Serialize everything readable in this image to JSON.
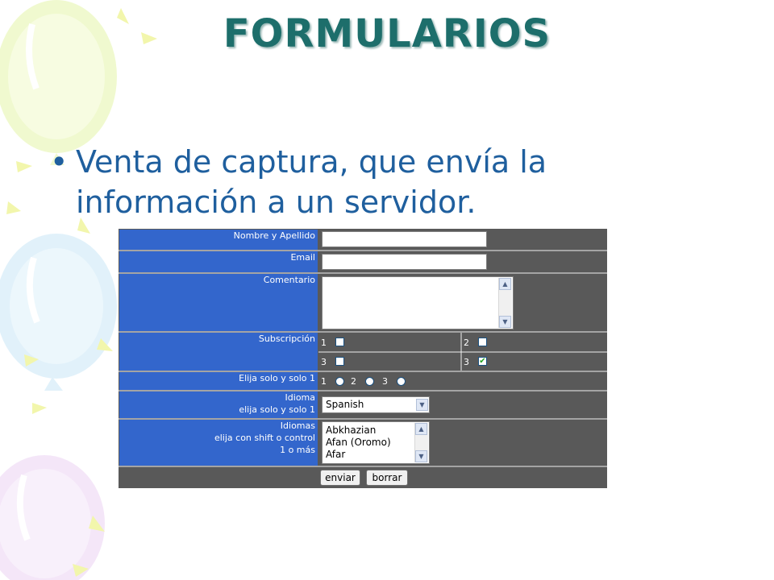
{
  "title": "FORMULARIOS",
  "bullet": {
    "marker": "•",
    "text": "Venta de captura, que envía la información a un servidor."
  },
  "form": {
    "name_label": "Nombre y Apellido",
    "name_value": "",
    "email_label": "Email",
    "email_value": "",
    "comment_label": "Comentario",
    "comment_value": "",
    "subscription_label": "Subscripción",
    "subscription_options": [
      {
        "label": "1",
        "checked": false
      },
      {
        "label": "2",
        "checked": false
      },
      {
        "label": "3",
        "checked": false
      },
      {
        "label": "3",
        "checked": true
      }
    ],
    "radio_label": "Elija solo y solo 1",
    "radio_options": [
      "1",
      "2",
      "3"
    ],
    "language_label_line1": "Idioma",
    "language_label_line2": "elija solo y solo 1",
    "language_selected": "Spanish",
    "languages_label_line1": "Idiomas",
    "languages_label_line2": "elija con shift o control",
    "languages_label_line3": "1 o más",
    "languages_list": [
      "Abkhazian",
      "Afan (Oromo)",
      "Afar"
    ],
    "submit_label": "enviar",
    "reset_label": "borrar"
  },
  "colors": {
    "title": "#1d6e6b",
    "bullet_text": "#1f5f9e",
    "label_bg": "#3366cc",
    "form_bg": "#595959"
  }
}
